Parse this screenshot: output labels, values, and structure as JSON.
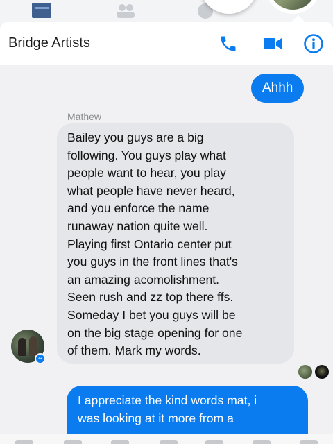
{
  "header": {
    "title": "Bridge Artists",
    "accent": "#0a7cf0"
  },
  "icons": {
    "call": "phone-icon",
    "video": "video-camera-icon",
    "info": "info-icon"
  },
  "messages": {
    "outgoing_1": "Ahhh",
    "incoming_sender": "Mathew",
    "incoming_lines": [
      "Bailey you guys are a big",
      "following. You guys play what",
      "people want to hear, you play",
      "what people have never heard,",
      "and you enforce the name",
      "runaway nation quite well.",
      "Playing first Ontario center put",
      "you guys in the front lines that's",
      "an amazing acomolishment.",
      "Seen rush and zz top there ffs.",
      "Someday I bet you guys will be",
      "on the big stage opening for one",
      "of them. Mark my words."
    ],
    "outgoing_2_lines": [
      "I appreciate the kind words mat, i",
      "was looking at it more from a"
    ]
  },
  "colors": {
    "outgoing_bubble": "#0a7cf0",
    "incoming_bubble": "#e5e6ea",
    "background": "#f1f1f3"
  }
}
